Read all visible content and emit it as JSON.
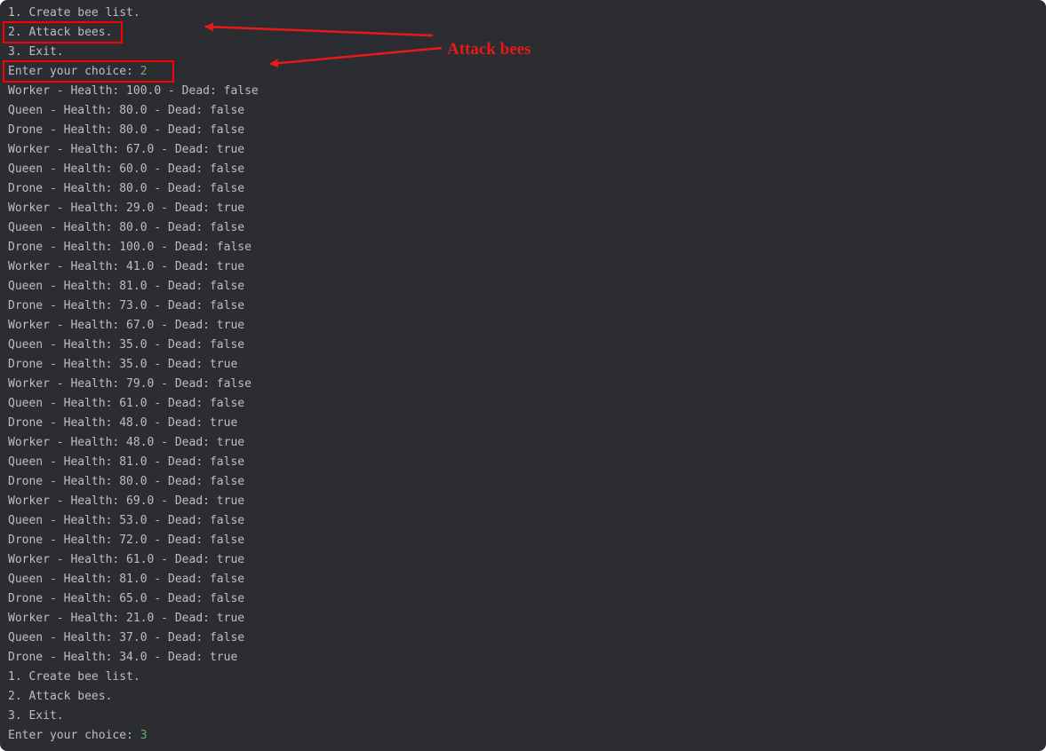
{
  "console": {
    "menu_top": [
      "1. Create bee list.",
      "2. Attack bees.",
      "3. Exit."
    ],
    "prompt_first": {
      "label": "Enter your choice: ",
      "value": "2"
    },
    "bee_rows": [
      "Worker - Health: 100.0 - Dead: false",
      "Queen - Health: 80.0 - Dead: false",
      "Drone - Health: 80.0 - Dead: false",
      "Worker - Health: 67.0 - Dead: true",
      "Queen - Health: 60.0 - Dead: false",
      "Drone - Health: 80.0 - Dead: false",
      "Worker - Health: 29.0 - Dead: true",
      "Queen - Health: 80.0 - Dead: false",
      "Drone - Health: 100.0 - Dead: false",
      "Worker - Health: 41.0 - Dead: true",
      "Queen - Health: 81.0 - Dead: false",
      "Drone - Health: 73.0 - Dead: false",
      "Worker - Health: 67.0 - Dead: true",
      "Queen - Health: 35.0 - Dead: false",
      "Drone - Health: 35.0 - Dead: true",
      "Worker - Health: 79.0 - Dead: false",
      "Queen - Health: 61.0 - Dead: false",
      "Drone - Health: 48.0 - Dead: true",
      "Worker - Health: 48.0 - Dead: true",
      "Queen - Health: 81.0 - Dead: false",
      "Drone - Health: 80.0 - Dead: false",
      "Worker - Health: 69.0 - Dead: true",
      "Queen - Health: 53.0 - Dead: false",
      "Drone - Health: 72.0 - Dead: false",
      "Worker - Health: 61.0 - Dead: true",
      "Queen - Health: 81.0 - Dead: false",
      "Drone - Health: 65.0 - Dead: false",
      "Worker - Health: 21.0 - Dead: true",
      "Queen - Health: 37.0 - Dead: false",
      "Drone - Health: 34.0 - Dead: true"
    ],
    "menu_bottom": [
      "1. Create bee list.",
      "2. Attack bees.",
      "3. Exit."
    ],
    "prompt_second": {
      "label": "Enter your choice: ",
      "value": "3"
    }
  },
  "annotation": {
    "label": "Attack bees",
    "color": "#e8191b"
  },
  "colors": {
    "background": "#2b2d30",
    "text": "#bcbec4",
    "input": "#6aab73"
  }
}
